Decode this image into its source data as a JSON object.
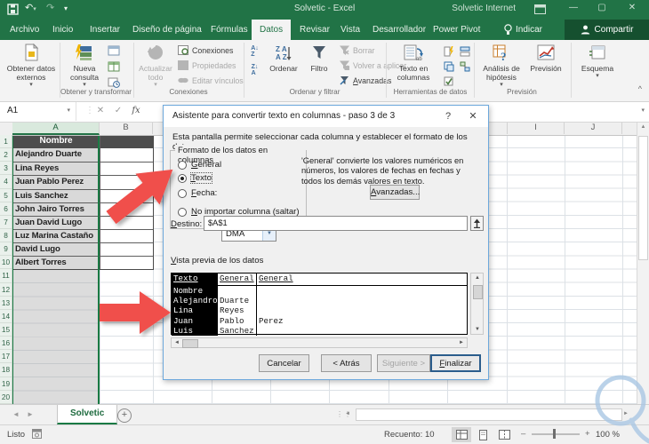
{
  "colors": {
    "accent_green": "#217346",
    "share_green": "#15502f",
    "arrow_red": "#f04f4b",
    "dialog_border": "#6da8dc",
    "header_cell_gray": "#4d4d4d",
    "selected_fill_gray": "#d9d9d9"
  },
  "icons": {
    "undo": "↶",
    "redo": "↷",
    "dropdown": "▾",
    "up": "▲",
    "down": "▼",
    "left": "◄",
    "right": "►",
    "close": "✕",
    "minimize": "—",
    "maximize": "▢",
    "help": "?",
    "check": "✓",
    "cancel_x": "✕",
    "fx": "fx",
    "collapse": "^",
    "drag_dots": "⋮⋮"
  },
  "titlebar": {
    "title": "Solvetic - Excel",
    "user": "Solvetic Internet"
  },
  "tabs": [
    {
      "label": "Archivo"
    },
    {
      "label": "Inicio"
    },
    {
      "label": "Insertar"
    },
    {
      "label": "Diseño de página"
    },
    {
      "label": "Fórmulas"
    },
    {
      "label": "Datos",
      "active": true
    },
    {
      "label": "Revisar"
    },
    {
      "label": "Vista"
    },
    {
      "label": "Desarrollador"
    },
    {
      "label": "Power Pivot"
    }
  ],
  "tell_me": "Indicar",
  "share": "Compartir",
  "ribbon": {
    "get_external": "Obtener datos externos",
    "new_query": "Nueva consulta",
    "refresh_all": "Actualizar todo",
    "connections": "Conexiones",
    "properties": "Propiedades",
    "edit_links": "Editar vínculos",
    "sort": "Ordenar",
    "filter": "Filtro",
    "clear": "Borrar",
    "reapply": "Volver a aplicar",
    "advanced": "Avanzadas",
    "text_to_columns": "Texto en columnas",
    "what_if": "Análisis de hipótesis",
    "forecast": "Previsión",
    "outline": "Esquema",
    "group_labels": {
      "g1": "Obtener y transformar",
      "g2": "Conexiones",
      "g3": "Ordenar y filtrar",
      "g4": "Herramientas de datos",
      "g5": "Previsión"
    }
  },
  "formula_bar": {
    "name_box": "A1"
  },
  "sheet": {
    "col_headers": [
      "A",
      "B",
      "I",
      "J"
    ],
    "row_numbers": [
      "1",
      "2",
      "3",
      "4",
      "5",
      "6",
      "7",
      "8",
      "9",
      "10",
      "11",
      "12",
      "13",
      "14",
      "15",
      "16",
      "17",
      "18",
      "19",
      "20"
    ],
    "header_cell": "Nombre",
    "names": [
      "Alejandro Duarte",
      "Lina Reyes",
      "Juan Pablo Perez",
      "Luis Sanchez",
      "John Jairo Torres",
      "Juan David Lugo",
      "Luz Marina Castaño",
      "David Lugo",
      "Albert Torres"
    ]
  },
  "dialog": {
    "title": "Asistente para convertir texto en columnas - paso 3 de 3",
    "intro": "Esta pantalla permite seleccionar cada columna y establecer el formato de los datos.",
    "format_group": "Formato de los datos en columnas",
    "radio_general": "General",
    "radio_text": "Texto",
    "radio_date": "Fecha:",
    "radio_skip": "No importar columna (saltar)",
    "date_format": "DMA",
    "general_note": "'General' convierte los valores numéricos en números, los valores de fechas en fechas y todos los demás valores en texto.",
    "advanced_btn": "Avanzadas...",
    "dest_label": "Destino:",
    "dest_value": "$A$1",
    "preview_label": "Vista previa de los datos",
    "preview_headers": [
      "Texto",
      "General",
      "General"
    ],
    "preview_rows": [
      [
        "Nombre",
        "",
        ""
      ],
      [
        "Alejandro",
        "Duarte",
        ""
      ],
      [
        "Lina",
        "Reyes",
        ""
      ],
      [
        "Juan",
        "Pablo",
        "Perez"
      ],
      [
        "Luis",
        "Sanchez",
        ""
      ]
    ],
    "buttons": {
      "cancel": "Cancelar",
      "back": "< Atrás",
      "next": "Siguiente >",
      "finish": "Finalizar"
    }
  },
  "sheet_tabs": {
    "active": "Solvetic"
  },
  "status": {
    "mode": "Listo",
    "count": "Recuento: 10",
    "zoom": "100 %"
  }
}
